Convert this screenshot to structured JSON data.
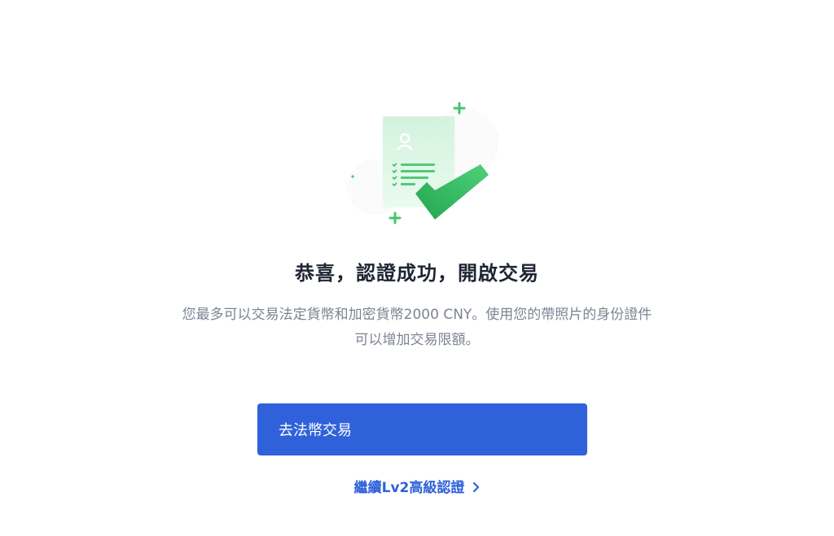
{
  "success": {
    "title": "恭喜，認證成功，開啟交易",
    "description_line1": "您最多可以交易法定貨幣和加密貨幣2000 CNY。使用您的帶照片的身份證件",
    "description_line2": "可以增加交易限額。"
  },
  "actions": {
    "primary_label": "去法幣交易",
    "secondary_link_label": "繼續Lv2高級認證"
  },
  "icons": {
    "illustration": "verified-document-icon",
    "link_chevron": "chevron-right-icon"
  },
  "colors": {
    "accent": "#2f62da",
    "success": "#2ebd5f",
    "title": "#1f2533",
    "muted": "#7d8492"
  }
}
